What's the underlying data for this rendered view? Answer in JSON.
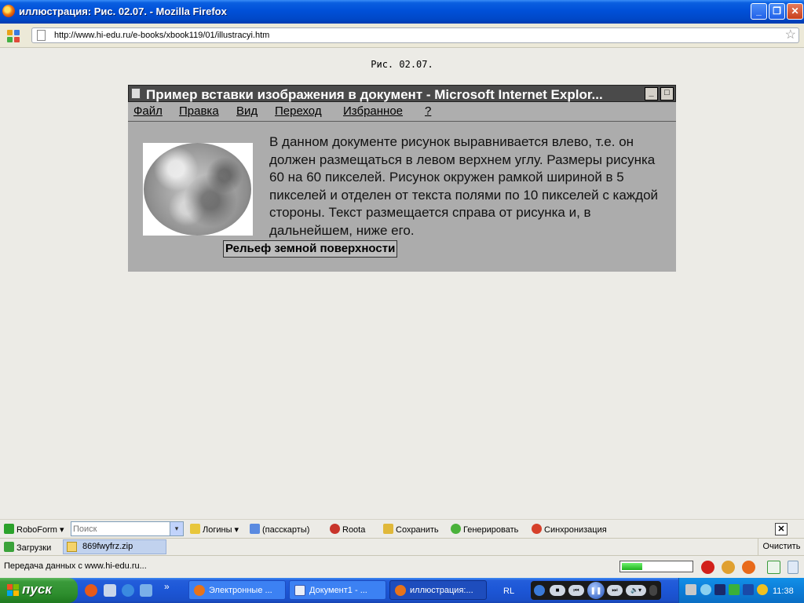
{
  "window": {
    "title": "иллюстрация: Рис. 02.07. - Mozilla Firefox",
    "minimize": "_",
    "restore": "❐",
    "close": "✕"
  },
  "navbar": {
    "url": "http://www.hi-edu.ru/e-books/xbook119/01/illustracyi.htm",
    "star_icon": "☆"
  },
  "page": {
    "caption": "Рис. 02.07.",
    "ie_window": {
      "title": "Пример вставки изображения в документ - Microsoft Internet Explor...",
      "minimize": "_",
      "maximize": "□",
      "menu": [
        "Файл",
        "Правка",
        "Вид",
        "Переход",
        "Избранное",
        "?"
      ],
      "text": "В данном документе рисунок выравнивается влево, т.е. он должен размещаться в левом верхнем углу. Размеры рисунка 60 на 60 пикселей. Рисунок окружен рамкой шириной в 5 пикселей и отделен от текста полями по 10 пикселей с каждой стороны. Текст размещается справа от рисунка и, в дальнейшем, ниже его.",
      "image_label": "Рельеф земной поверхности"
    }
  },
  "roboform": {
    "name": "RoboForm",
    "dropdown": "▾",
    "search_placeholder": "Поиск",
    "logins": "Логины",
    "passcards": "(пасскарты)",
    "roota": "Roota",
    "save": "Сохранить",
    "generate": "Генерировать",
    "sync": "Синхронизация",
    "close": "✕"
  },
  "downloads": {
    "label": "Загрузки",
    "file": "869fwyfrz.zip",
    "clear": "Очистить"
  },
  "status": {
    "text": "Передача данных с www.hi-edu.ru...",
    "progress": 0.3
  },
  "taskbar": {
    "start": "пуск",
    "quicklaunch_more": "»",
    "tasks": [
      "Электронные ...",
      "Документ1 - ...",
      "иллюстрация:..."
    ],
    "lang": "RL",
    "player": {
      "stop": "■",
      "prev": "⏮",
      "play": "❚❚",
      "next": "⏭",
      "volume": "🔈▾"
    },
    "clock": "11:38"
  },
  "colors": {
    "xp_blue": "#0050d8",
    "start_green": "#3a9a3a",
    "tray_blue": "#0c7dd8",
    "progress_green": "#1fb21f"
  }
}
